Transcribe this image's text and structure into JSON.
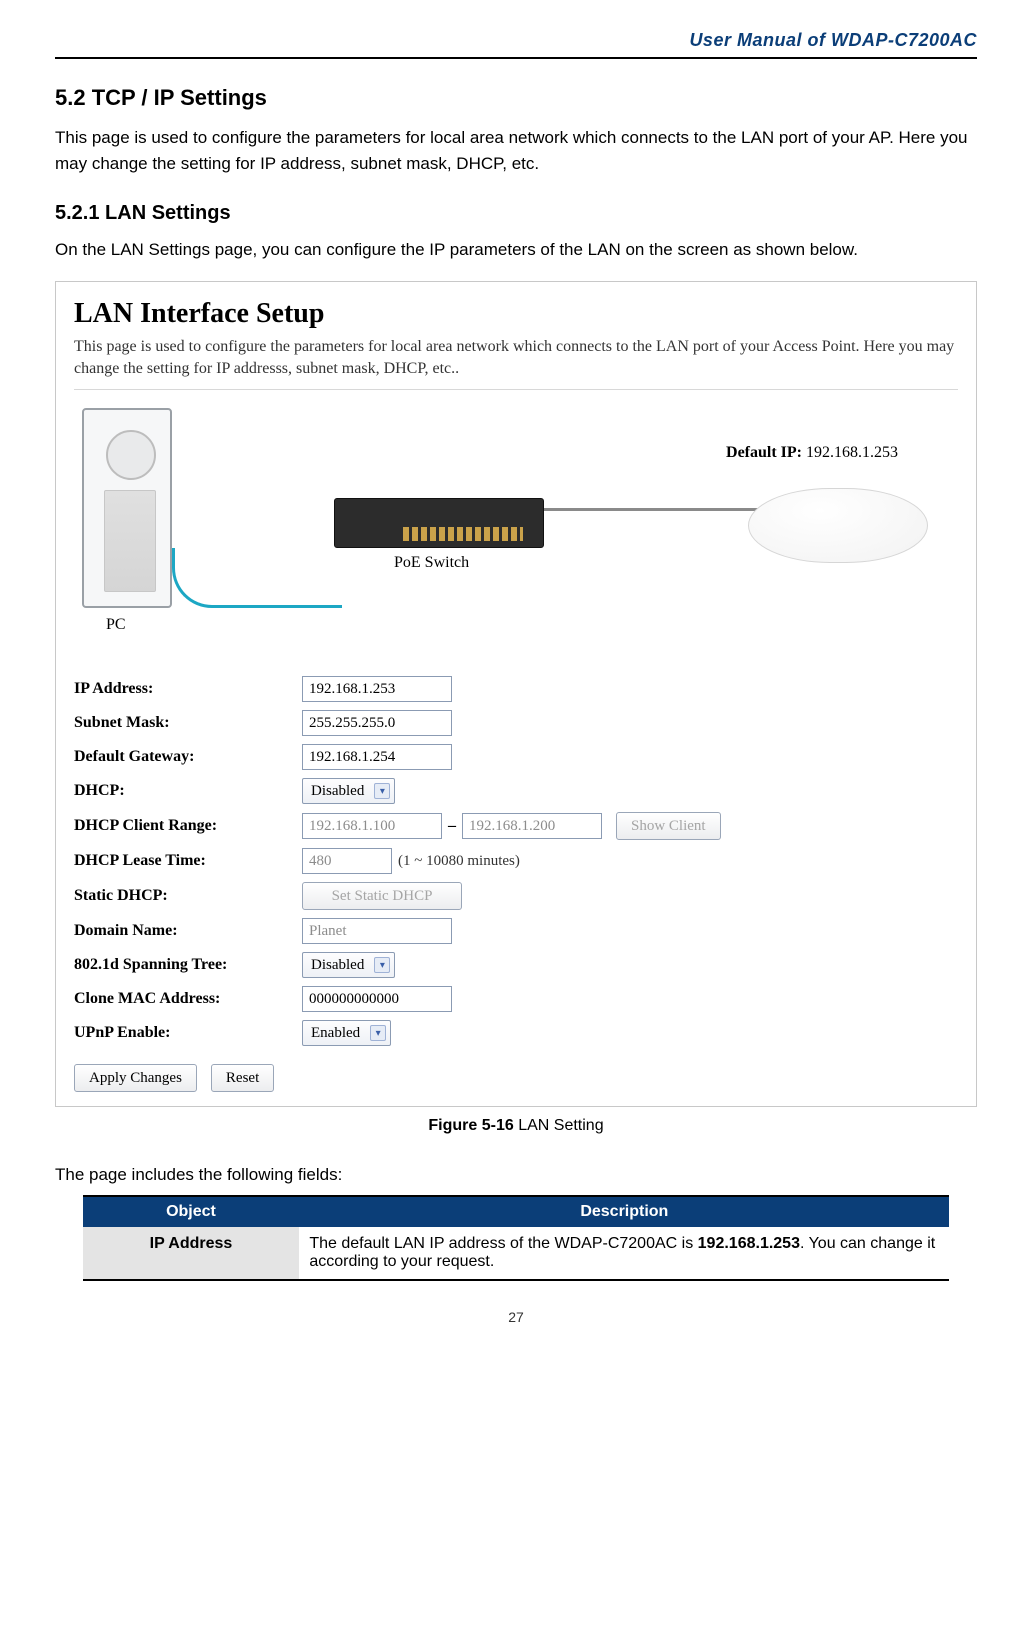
{
  "header": {
    "title": "User Manual of WDAP-C7200AC"
  },
  "section": {
    "num_title": "5.2  TCP / IP Settings",
    "para": "This page is used to configure the parameters for local area network which connects to the LAN port of your AP. Here you may change the setting for IP address, subnet mask, DHCP, etc.",
    "sub_num_title": "5.2.1  LAN Settings",
    "sub_para": "On the LAN Settings page, you can configure the IP parameters of the LAN on the screen as shown below."
  },
  "figure": {
    "title": "LAN Interface Setup",
    "desc": "This page is used to configure the parameters for local area network which connects to the LAN port of your Access Point. Here you may change the setting for IP addresss, subnet mask, DHCP, etc..",
    "pc_label": "PC",
    "switch_label": "PoE Switch",
    "default_ip_label": "Default IP:",
    "default_ip_value": "192.168.1.253"
  },
  "form": {
    "ip_address": {
      "label": "IP Address:",
      "value": "192.168.1.253"
    },
    "subnet_mask": {
      "label": "Subnet Mask:",
      "value": "255.255.255.0"
    },
    "default_gateway": {
      "label": "Default Gateway:",
      "value": "192.168.1.254"
    },
    "dhcp": {
      "label": "DHCP:",
      "value": "Disabled"
    },
    "dhcp_range": {
      "label": "DHCP Client Range:",
      "from": "192.168.1.100",
      "to": "192.168.1.200",
      "show_client": "Show Client"
    },
    "dhcp_lease": {
      "label": "DHCP Lease Time:",
      "value": "480",
      "hint": "(1 ~ 10080 minutes)"
    },
    "static_dhcp": {
      "label": "Static DHCP:",
      "button": "Set Static DHCP"
    },
    "domain_name": {
      "label": "Domain Name:",
      "placeholder": "Planet"
    },
    "spanning_tree": {
      "label": "802.1d Spanning Tree:",
      "value": "Disabled"
    },
    "clone_mac": {
      "label": "Clone MAC Address:",
      "value": "000000000000"
    },
    "upnp": {
      "label": "UPnP Enable:",
      "value": "Enabled"
    },
    "apply": "Apply Changes",
    "reset": "Reset"
  },
  "caption": {
    "bold": "Figure 5-16",
    "rest": " LAN Setting"
  },
  "table": {
    "intro": "The page includes the following fields:",
    "headers": {
      "object": "Object",
      "description": "Description"
    },
    "rows": [
      {
        "object": "IP Address",
        "desc_pre": "The default LAN IP address of the WDAP-C7200AC is ",
        "desc_bold": "192.168.1.253",
        "desc_post": ". You can change it according to your request."
      }
    ]
  },
  "page_number": "27"
}
